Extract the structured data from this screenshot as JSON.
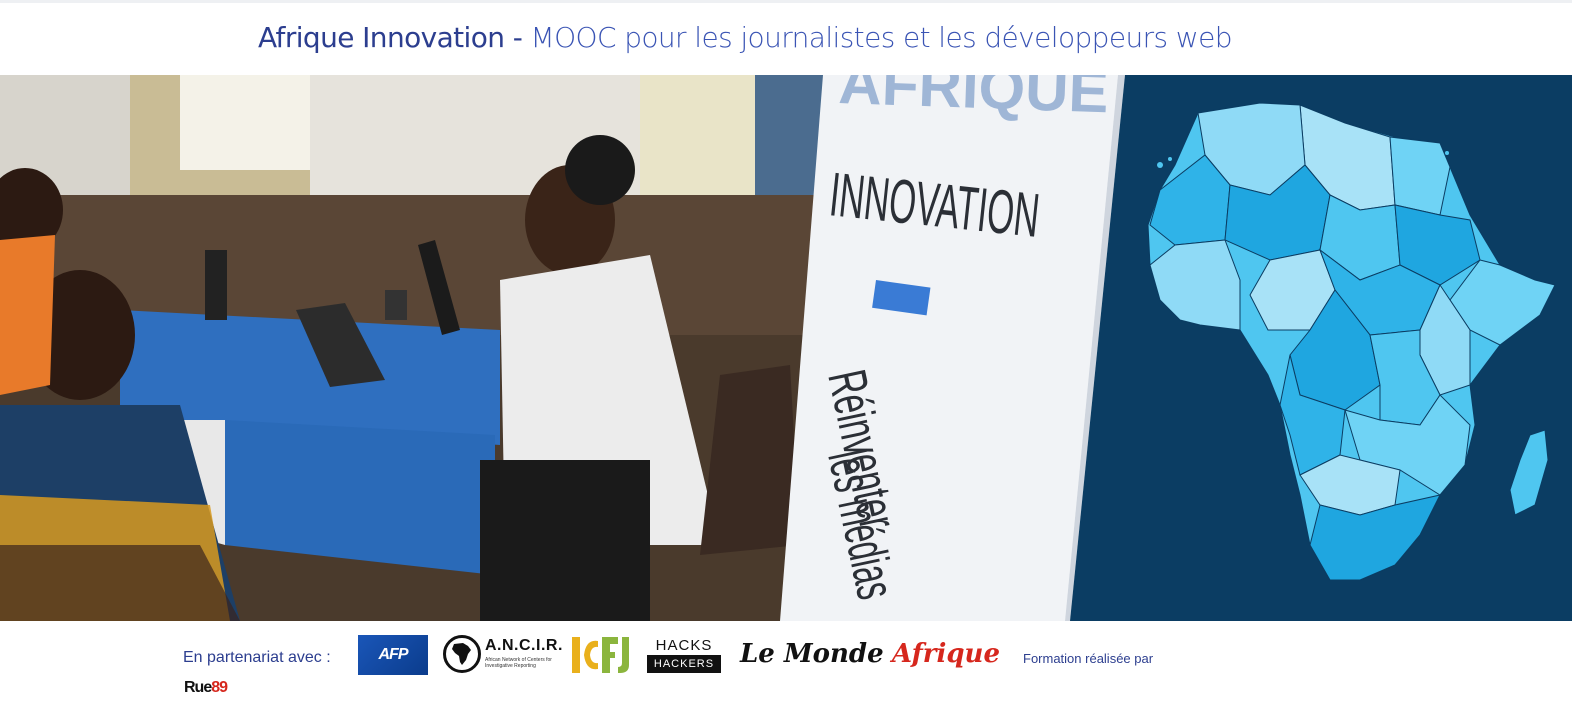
{
  "header": {
    "brand": "Afrique Innovation",
    "separator": " - ",
    "tagline": "MOOC pour les journalistes et les développeurs web"
  },
  "banner": {
    "poster_line1": "AFRIQUE",
    "poster_line2": "INNOVATION",
    "poster_line3": "Réinventer",
    "poster_line4": "les médias",
    "colors": {
      "map_background": "#0b3d63",
      "map_light": "#a8e2f7",
      "map_mid": "#4fc6f0",
      "map_dark": "#1fa6e0",
      "poster_accent": "#3a7bd5"
    }
  },
  "partners": {
    "label": "En partenariat avec :",
    "made_by": "Formation réalisée par",
    "afp": "AFP",
    "ancir_name": "A.N.C.I.R.",
    "ancir_sub": "African Network of Centers for Investigative Reporting",
    "icfj": "ICFJ",
    "hacks_top": "HACKS",
    "hacks_bottom": "HACKERS",
    "monde_a": "Le Monde",
    "monde_b": "Afrique",
    "rue_a": "Rue",
    "rue_b": "89"
  }
}
